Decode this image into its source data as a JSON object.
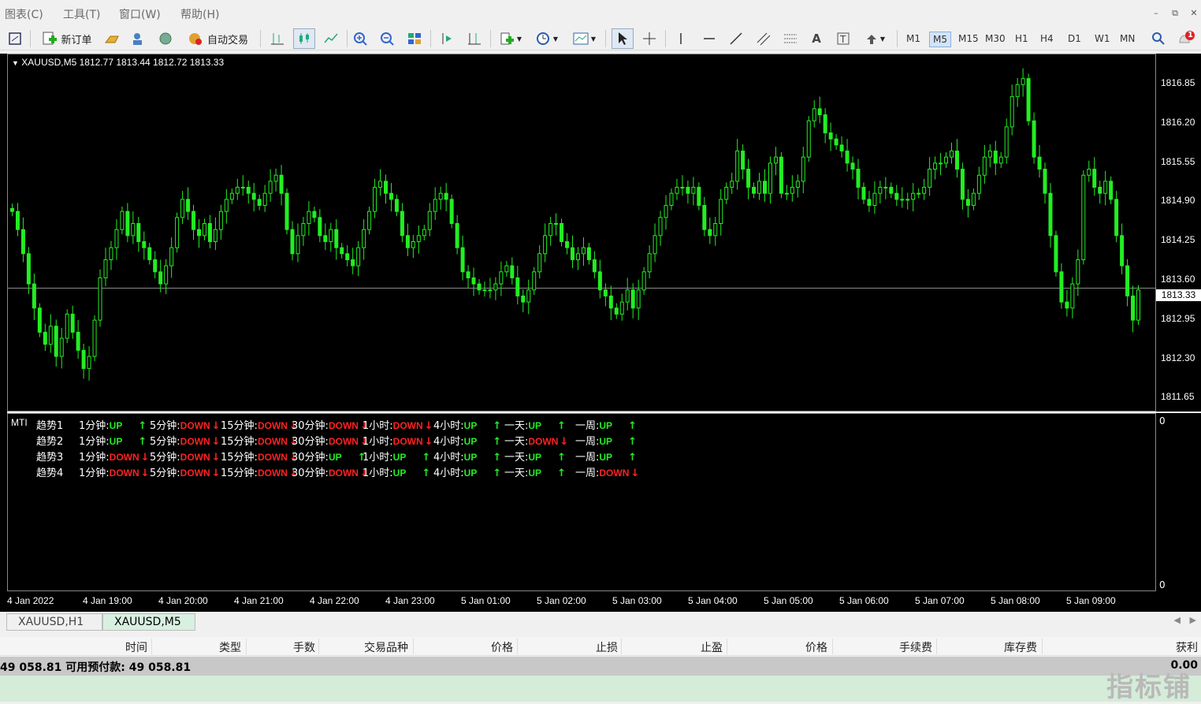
{
  "menu": {
    "items": [
      "图表(C)",
      "工具(T)",
      "窗口(W)",
      "帮助(H)"
    ]
  },
  "toolbar": {
    "new_order_label": "新订单",
    "auto_trading_label": "自动交易",
    "timeframes": [
      "M1",
      "M5",
      "M15",
      "M30",
      "H1",
      "H4",
      "D1",
      "W1",
      "MN"
    ],
    "active_timeframe": "M5",
    "notification_count": "1"
  },
  "chart": {
    "symbol_info": "XAUUSD,M5  1812.77 1813.44 1812.72 1813.33",
    "current_price": "1813.33",
    "candle_color": "#22ee22",
    "background": "#000000",
    "price_ticks": [
      "1816.85",
      "1816.20",
      "1815.55",
      "1814.90",
      "1814.25",
      "1813.60",
      "1812.95",
      "1812.30",
      "1811.65"
    ],
    "time_ticks": [
      "4 Jan 2022",
      "4 Jan 19:00",
      "4 Jan 20:00",
      "4 Jan 21:00",
      "4 Jan 22:00",
      "4 Jan 23:00",
      "5 Jan 01:00",
      "5 Jan 02:00",
      "5 Jan 03:00",
      "5 Jan 04:00",
      "5 Jan 05:00",
      "5 Jan 06:00",
      "5 Jan 07:00",
      "5 Jan 08:00",
      "5 Jan 09:00"
    ]
  },
  "chart_data": {
    "type": "candlestick",
    "title": "XAUUSD,M5",
    "ylim": [
      1811.3,
      1817.2
    ],
    "close_series": [
      1814.6,
      1814.3,
      1813.9,
      1813.4,
      1813.0,
      1812.6,
      1812.4,
      1812.7,
      1812.2,
      1812.5,
      1812.9,
      1812.6,
      1812.3,
      1812.0,
      1812.2,
      1812.8,
      1813.5,
      1813.8,
      1814.0,
      1814.3,
      1814.6,
      1814.2,
      1814.4,
      1814.1,
      1814.0,
      1813.8,
      1813.6,
      1813.4,
      1813.7,
      1814.0,
      1814.5,
      1814.8,
      1814.6,
      1814.3,
      1814.2,
      1814.4,
      1814.1,
      1814.3,
      1814.6,
      1814.8,
      1814.9,
      1815.0,
      1815.0,
      1814.9,
      1814.8,
      1814.7,
      1814.9,
      1815.1,
      1815.2,
      1814.9,
      1814.3,
      1813.9,
      1814.2,
      1814.4,
      1814.6,
      1814.5,
      1814.2,
      1814.1,
      1814.3,
      1814.0,
      1813.9,
      1813.8,
      1813.7,
      1814.0,
      1814.3,
      1814.6,
      1815.0,
      1815.1,
      1814.9,
      1814.8,
      1814.6,
      1814.2,
      1814.0,
      1814.1,
      1814.2,
      1814.3,
      1814.6,
      1814.8,
      1814.9,
      1814.8,
      1814.4,
      1814.0,
      1813.6,
      1813.5,
      1813.4,
      1813.3,
      1813.3,
      1813.3,
      1813.4,
      1813.6,
      1813.7,
      1813.5,
      1813.2,
      1813.1,
      1813.3,
      1813.6,
      1813.9,
      1814.2,
      1814.4,
      1814.4,
      1814.1,
      1814.0,
      1813.8,
      1813.9,
      1814.0,
      1813.8,
      1813.6,
      1813.3,
      1813.2,
      1813.0,
      1812.9,
      1813.1,
      1813.3,
      1813.0,
      1813.3,
      1813.6,
      1813.9,
      1814.2,
      1814.5,
      1814.7,
      1814.9,
      1815.0,
      1815.0,
      1814.9,
      1815.0,
      1814.7,
      1814.3,
      1814.2,
      1814.4,
      1814.8,
      1815.0,
      1815.1,
      1815.6,
      1815.3,
      1815.0,
      1814.9,
      1815.1,
      1814.9,
      1815.4,
      1815.5,
      1814.9,
      1814.9,
      1815.0,
      1815.1,
      1815.5,
      1816.1,
      1816.3,
      1816.2,
      1815.9,
      1815.8,
      1815.7,
      1815.6,
      1815.4,
      1815.3,
      1815.0,
      1814.8,
      1814.7,
      1814.9,
      1815.0,
      1815.0,
      1814.9,
      1814.8,
      1814.8,
      1814.8,
      1814.9,
      1814.9,
      1815.0,
      1815.3,
      1815.4,
      1815.4,
      1815.5,
      1815.6,
      1815.3,
      1814.8,
      1814.7,
      1814.9,
      1815.2,
      1815.5,
      1815.6,
      1815.4,
      1815.5,
      1816.0,
      1816.5,
      1816.7,
      1816.8,
      1816.1,
      1815.5,
      1815.3,
      1814.9,
      1814.2,
      1813.6,
      1813.1,
      1813.0,
      1813.4,
      1813.8,
      1815.2,
      1815.3,
      1815.0,
      1814.9,
      1815.1,
      1814.8,
      1814.2,
      1813.7,
      1813.2,
      1812.8,
      1813.3
    ],
    "last": {
      "open": 1812.77,
      "high": 1813.44,
      "low": 1812.72,
      "close": 1813.33
    },
    "xlabel": "",
    "ylabel": ""
  },
  "indicator": {
    "name": "MTI",
    "scale_top": "0",
    "scale_bottom": "0",
    "rows": [
      {
        "label": "趋势1",
        "items": [
          {
            "tf": "1分钟:",
            "dir": "UP"
          },
          {
            "tf": "5分钟:",
            "dir": "DOWN"
          },
          {
            "tf": "15分钟:",
            "dir": "DOWN"
          },
          {
            "tf": "30分钟:",
            "dir": "DOWN"
          },
          {
            "tf": "1小时:",
            "dir": "DOWN"
          },
          {
            "tf": "4小时:",
            "dir": "UP"
          },
          {
            "tf": "一天:",
            "dir": "UP"
          },
          {
            "tf": "一周:",
            "dir": "UP"
          }
        ]
      },
      {
        "label": "趋势2",
        "items": [
          {
            "tf": "1分钟:",
            "dir": "UP"
          },
          {
            "tf": "5分钟:",
            "dir": "DOWN"
          },
          {
            "tf": "15分钟:",
            "dir": "DOWN"
          },
          {
            "tf": "30分钟:",
            "dir": "DOWN"
          },
          {
            "tf": "1小时:",
            "dir": "DOWN"
          },
          {
            "tf": "4小时:",
            "dir": "UP"
          },
          {
            "tf": "一天:",
            "dir": "DOWN"
          },
          {
            "tf": "一周:",
            "dir": "UP"
          }
        ]
      },
      {
        "label": "趋势3",
        "items": [
          {
            "tf": "1分钟:",
            "dir": "DOWN"
          },
          {
            "tf": "5分钟:",
            "dir": "DOWN"
          },
          {
            "tf": "15分钟:",
            "dir": "DOWN"
          },
          {
            "tf": "30分钟:",
            "dir": "UP"
          },
          {
            "tf": "1小时:",
            "dir": "UP"
          },
          {
            "tf": "4小时:",
            "dir": "UP"
          },
          {
            "tf": "一天:",
            "dir": "UP"
          },
          {
            "tf": "一周:",
            "dir": "UP"
          }
        ]
      },
      {
        "label": "趋势4",
        "items": [
          {
            "tf": "1分钟:",
            "dir": "DOWN"
          },
          {
            "tf": "5分钟:",
            "dir": "DOWN"
          },
          {
            "tf": "15分钟:",
            "dir": "DOWN"
          },
          {
            "tf": "30分钟:",
            "dir": "DOWN"
          },
          {
            "tf": "1小时:",
            "dir": "UP"
          },
          {
            "tf": "4小时:",
            "dir": "UP"
          },
          {
            "tf": "一天:",
            "dir": "UP"
          },
          {
            "tf": "一周:",
            "dir": "DOWN"
          }
        ]
      }
    ]
  },
  "tabs": [
    {
      "label": "XAUUSD,H1",
      "active": false
    },
    {
      "label": "XAUUSD,M5",
      "active": true
    }
  ],
  "terminal": {
    "columns": [
      "时间",
      "类型",
      "手数",
      "交易品种",
      "价格",
      "止损",
      "止盈",
      "价格",
      "手续费",
      "库存费",
      "获利"
    ],
    "balance_text": "49 058.81  可用预付款: 49 058.81",
    "profit": "0.00"
  },
  "watermark": "指标铺"
}
